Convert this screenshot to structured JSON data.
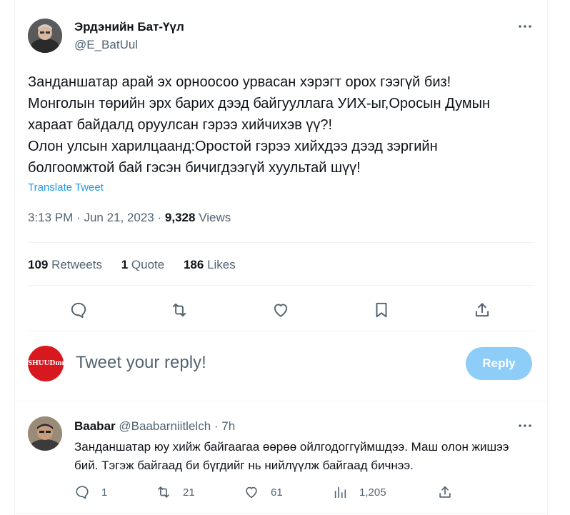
{
  "tweet": {
    "author_name": "Эрдэнийн Бат-Үүл",
    "author_handle": "@E_BatUul",
    "text_lines": [
      "Занданшатар арай эх орноосоо урвасан хэрэгт орох гээгүй биз!",
      "Монголын төрийн эрх барих дээд байгууллага УИХ-ыг,Оросын Думын",
      "хараат байдалд оруулсан гэрээ хийчихэв үү?!",
      "Олон улсын харилцаанд:Оростой гэрээ хийхдээ дээд зэргийн",
      "болгоомжтой бай гэсэн бичигдээгүй хуультай шүү!"
    ],
    "translate_label": "Translate Tweet",
    "time": "3:13 PM",
    "date": "Jun 21, 2023",
    "views_count": "9,328",
    "views_label": "Views",
    "separator": "·"
  },
  "stats": {
    "retweets_count": "109",
    "retweets_label": "Retweets",
    "quotes_count": "1",
    "quotes_label": "Quote",
    "likes_count": "186",
    "likes_label": "Likes"
  },
  "icons": {
    "reply": "reply-icon",
    "retweet": "retweet-icon",
    "like": "heart-icon",
    "bookmark": "bookmark-icon",
    "share": "share-icon",
    "more": "more-icon",
    "views": "views-chart-icon"
  },
  "composer": {
    "avatar_text": "SHUUDmn",
    "placeholder": "Tweet your reply!",
    "button_label": "Reply"
  },
  "reply": {
    "author_name": "Baabar",
    "author_handle": "@Baabarniitlelch",
    "separator": "·",
    "age": "7h",
    "text": "Занданшатар юу хийж байгаагаа өөрөө ойлгодоггүймшдээ. Маш олон жишээ бий. Тэгэж байгаад би бүгдийг нь нийлүүлж байгаад бичнээ.",
    "reply_count": "1",
    "retweet_count": "21",
    "like_count": "61",
    "view_count": "1,205"
  },
  "colors": {
    "accent": "#1d9bf0",
    "muted": "#536471",
    "reply_button_disabled": "#8ecdf8",
    "composer_avatar": "#d7191f"
  }
}
